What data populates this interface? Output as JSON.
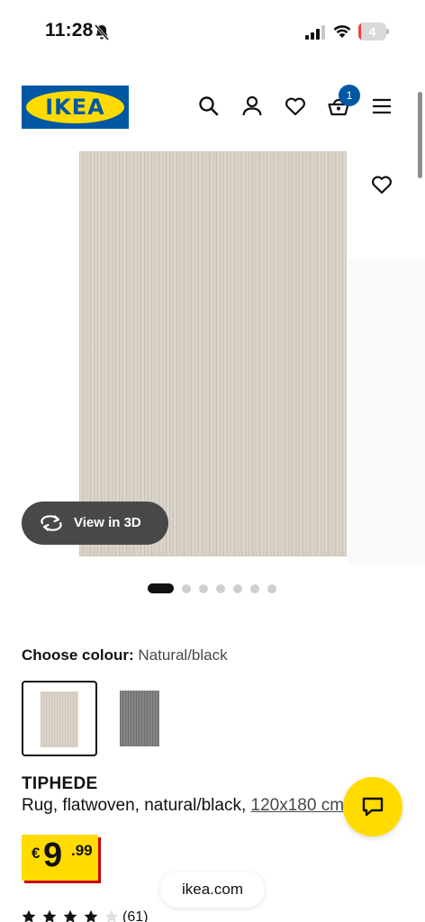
{
  "status_bar": {
    "time": "11:28",
    "battery_level": "4",
    "battery_fraction": 0.1,
    "battery_color": "#f4413a"
  },
  "header": {
    "logo_text": "IKEA",
    "cart_count": "1",
    "brand_blue": "#0058a3",
    "brand_yellow": "#ffdb00",
    "icons": [
      "search-icon",
      "user-icon",
      "heart-icon",
      "shopping-bag-icon",
      "menu-icon"
    ]
  },
  "gallery": {
    "view_3d_label": "View in 3D",
    "image_count": 7,
    "active_index": 0
  },
  "colour": {
    "label": "Choose colour:",
    "value": "Natural/black",
    "options": [
      "natural-black",
      "grey"
    ]
  },
  "product": {
    "name": "TIPHEDE",
    "description": "Rug, flatwoven, natural/black, ",
    "size": "120x180 cm",
    "price_currency": "€",
    "price_integer": "9",
    "price_decimal": ".99"
  },
  "rating": {
    "stars": 4,
    "max": 5,
    "count": "(61)"
  },
  "browser": {
    "url": "ikea.com"
  }
}
